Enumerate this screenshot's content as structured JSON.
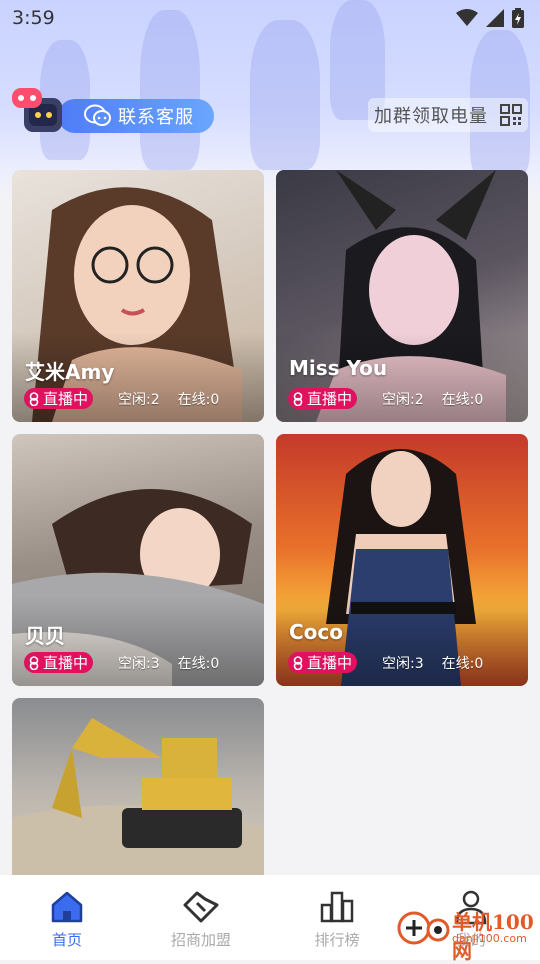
{
  "status_bar": {
    "time": "3:59"
  },
  "header": {
    "customer_service_label": "联系客服",
    "join_group_label": "加群领取电量"
  },
  "cards": [
    {
      "name": "艾米Amy",
      "live_label": "直播中",
      "idle": "空闲:2",
      "online": "在线:0"
    },
    {
      "name": "Miss You",
      "live_label": "直播中",
      "idle": "空闲:2",
      "online": "在线:0"
    },
    {
      "name": "贝贝",
      "live_label": "直播中",
      "idle": "空闲:3",
      "online": "在线:0"
    },
    {
      "name": "Coco",
      "live_label": "直播中",
      "idle": "空闲:3",
      "online": "在线:0"
    }
  ],
  "tabs": [
    {
      "label": "首页",
      "active": true
    },
    {
      "label": "招商加盟",
      "active": false
    },
    {
      "label": "排行榜",
      "active": false
    },
    {
      "label": "我的",
      "active": false
    }
  ],
  "watermark": {
    "text": "单机100网",
    "url": "danji100.com"
  },
  "colors": {
    "accent": "#3b6cf0",
    "live_badge": "#e0115f",
    "pill_start": "#4f7cf6",
    "pill_end": "#6aa6ff"
  }
}
